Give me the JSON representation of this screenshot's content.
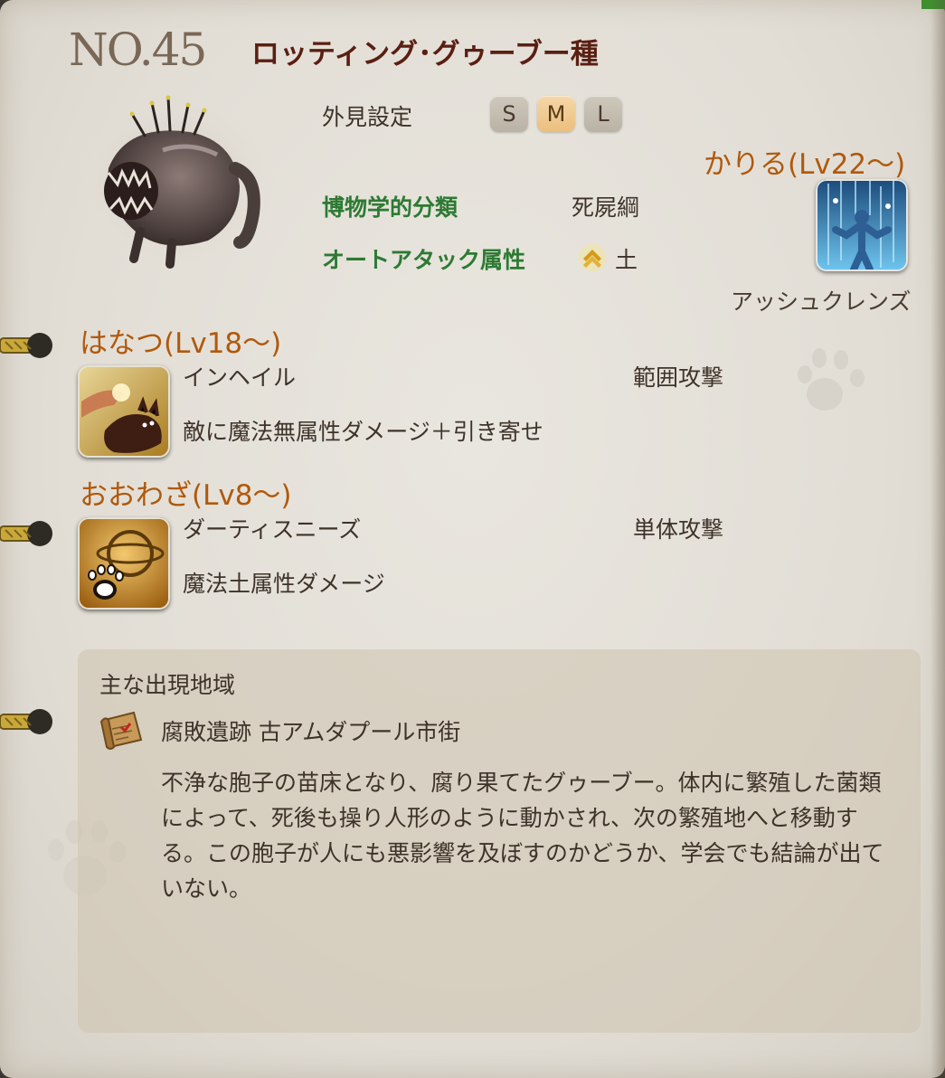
{
  "entry": {
    "number": "NO.45",
    "name": "ロッティング･グゥーブー種"
  },
  "appearance": {
    "label": "外見設定",
    "sizes": [
      "S",
      "M",
      "L"
    ],
    "selected": "M"
  },
  "classification": {
    "label": "博物学的分類",
    "value": "死屍綱"
  },
  "auto_attack": {
    "label": "オートアタック属性",
    "icon": "earth-element-icon",
    "value": "土"
  },
  "borrow": {
    "heading": "かりる(Lv22～)",
    "action_name": "アッシュクレンズ",
    "icon": "ash-cleanse-icon"
  },
  "release": {
    "heading": "はなつ(Lv18～)",
    "name": "インヘイル",
    "type": "範囲攻撃",
    "description": "敵に魔法無属性ダメージ＋引き寄せ",
    "icon": "inhale-icon"
  },
  "big_move": {
    "heading": "おおわざ(Lv8～)",
    "name": "ダーティスニーズ",
    "type": "単体攻撃",
    "description": "魔法土属性ダメージ",
    "icon": "dirty-sneeze-icon"
  },
  "habitat": {
    "title": "主な出現地域",
    "location": "腐敗遺跡 古アムダプール市街",
    "icon": "map-scroll-icon",
    "description": "不浄な胞子の苗床となり、腐り果てたグゥーブー。体内に繁殖した菌類によって、死後も操り人形のように動かされ、次の繁殖地へと移動する。この胞子が人にも悪影響を及ぼすのかどうか、学会でも結論が出ていない。"
  },
  "colors": {
    "title": "#5a1f12",
    "green_label": "#2d7a33",
    "orange_heading": "#b0590c",
    "selected_size": "#ebbf7d",
    "page_bg": "#e4e0d8"
  }
}
